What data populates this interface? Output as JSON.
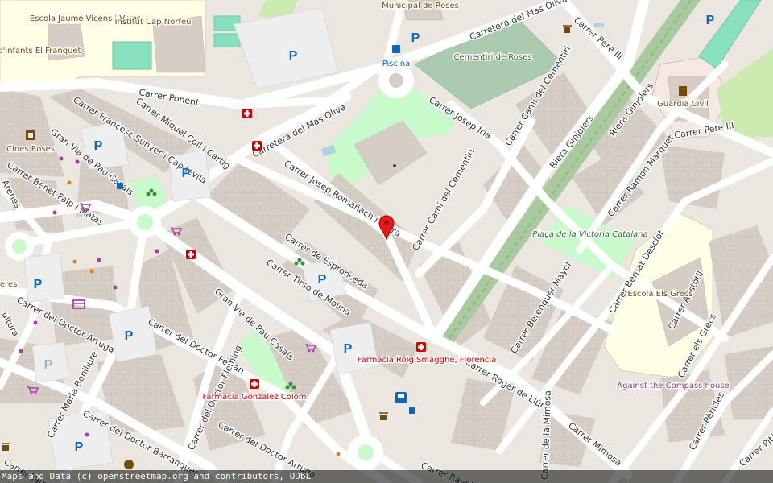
{
  "map": {
    "streets": [
      "Carrer Ponent",
      "Carrer Francesc Sunyer i Capdevila",
      "Carrer Miquel Coll i Cartig",
      "Carretera del Mas Oliva",
      "Carretera del Mas Oliva",
      "Carrer Pere III",
      "Carrer Pere III",
      "Carrer Camí del Cementiri",
      "Carrer Camí del Cementiri",
      "Carrer Josep Irla",
      "Riera Ginjolers",
      "Riera Ginjolers",
      "Carrer Ramon Marquet",
      "Gran Via de Pau Casals",
      "Gran Via de Pau Casals",
      "Carrer Benet Falp i Matas",
      "Carrer Josep Romañach i Serra",
      "Carrer de Espronceda",
      "Carrer Tirso de Molina",
      "Carrer del Doctor Arruga",
      "Carrer del Doctor Ferran",
      "Carrer del Doctor Fleming",
      "Carrer del Doctor Arruga",
      "Carrer del Doctor Barranquer",
      "Carrer Maria Benlliure",
      "Carrer Berenguer Mayol",
      "Carrer Bernat Desclot",
      "Carrer Roger de Llúria",
      "Carrer Mimosa",
      "Carrer de la Mimosa",
      "Carrer Aristòtil",
      "Carrer els Grecs",
      "Carrer Pèricles",
      "Carrer Pitàgoras",
      "Carrer Ravel",
      "Carrer Tarr",
      "Arenes",
      "ultura"
    ],
    "pois": {
      "escola_jaume": "Escola Jaume Vicens i Vives",
      "institut": "Institut Cap Norfeu",
      "llar": "Llar d'infants El Franquet",
      "municipal": "Municipal de Roses",
      "piscina": "Piscina",
      "cementiri": "Cementiri de Roses",
      "guardia": "Guardia Civil",
      "cines": "Cines Roses",
      "placa": "Plaça de la Victoria Catalana",
      "escola_grecs": "Escola Els Grecs",
      "farmacia_roig": "Farmacia Roig Smagghe, Florencia",
      "farmacia_gonzalez": "Farmacia Gonzalez Colom",
      "against": "Against the Compass house",
      "eres": "eres"
    },
    "parking_label": "P",
    "marker_icon": "map-pin-icon",
    "colors": {
      "background": "#f2efe9",
      "road": "#ffffff",
      "building": "#d9d0c9",
      "park": "#c8facc",
      "school": "#ffffe5",
      "cemetery": "#aacbaf",
      "pitch": "#88e0be",
      "rail": "#8fb78a",
      "marker": "#e31a1c",
      "pharmacy": "#c00000",
      "parking": "#0a6ab8"
    }
  },
  "attribution": "Maps and Data (c) openstreetmap.org and contributors, ODbL"
}
